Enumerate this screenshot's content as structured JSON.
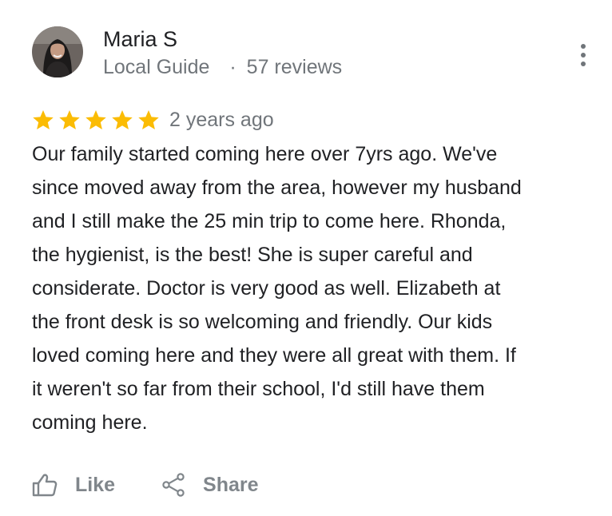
{
  "reviewer": {
    "name": "Maria S",
    "badge": "Local Guide",
    "separator": "·",
    "review_count": "57 reviews",
    "avatar": "profile-photo"
  },
  "more_options_icon": "more-vert-icon",
  "rating": {
    "stars": 5,
    "max": 5,
    "star_color": "#fbbc04",
    "date": "2 years ago"
  },
  "review": {
    "lines": [
      "Our family started coming here over 7yrs ago. We've",
      "since moved away from the area, however my husband",
      "and I still make the 25 min trip to come here. Rhonda,",
      "the hygienist, is the best! She is super careful and",
      "considerate. Doctor is very good as well. Elizabeth at",
      "the front desk is so welcoming and friendly. Our kids",
      "loved coming here and they were all great with them. If",
      "it weren't so far from their school, I'd still have them",
      "coming here."
    ]
  },
  "actions": {
    "like_label": "Like",
    "like_icon": "thumbs-up-icon",
    "share_label": "Share",
    "share_icon": "share-icon"
  },
  "colors": {
    "primary_text": "#202124",
    "secondary_text": "#70757a",
    "action_text": "#80868b",
    "star": "#fbbc04"
  }
}
